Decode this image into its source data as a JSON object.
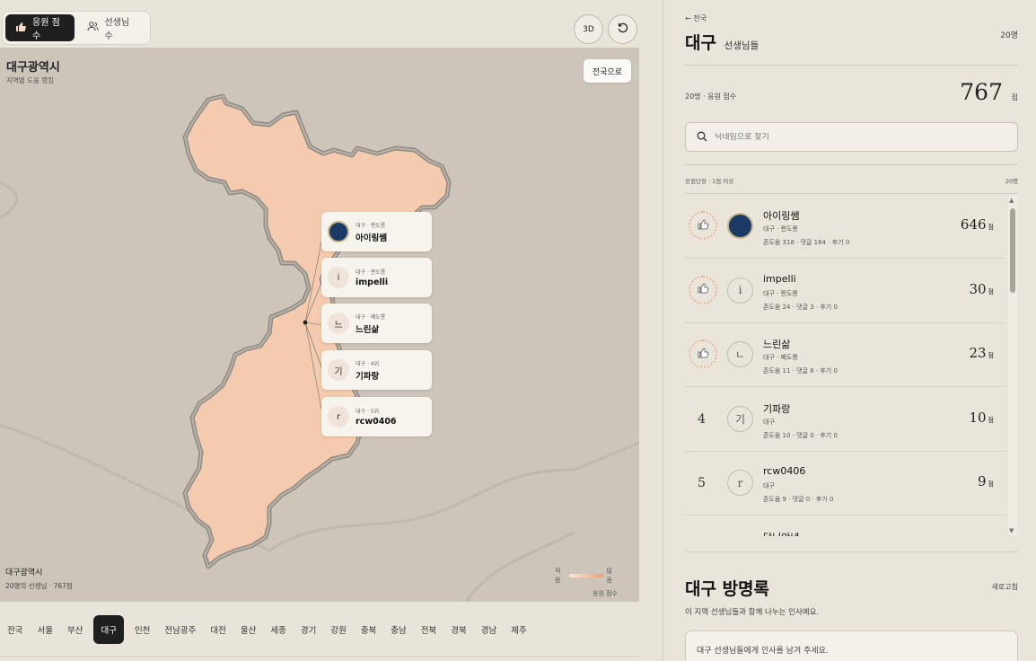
{
  "mode_toggle": {
    "score_label": "응원 점수",
    "teachers_label": "선생님 수"
  },
  "controls": {
    "btn_3d": "3D"
  },
  "map": {
    "title": "대구광역시",
    "subtitle": "지역별 도움 랭킹",
    "to_national": "전국으로",
    "footer_name": "대구광역시",
    "footer_stat": "20명의 선생님 · 767점",
    "legend_low": "적음",
    "legend_high": "많음",
    "legend_caption": "응원 점수",
    "fill_color": "#f4cbae",
    "cards": [
      {
        "meta": "대구 · 쩐도롱",
        "name": "아이링쌤",
        "avatar": ""
      },
      {
        "meta": "대구 · 쩐도롱",
        "name": "impelli",
        "avatar": "i"
      },
      {
        "meta": "대구 · 쩨도롱",
        "name": "느린삶",
        "avatar": "느"
      },
      {
        "meta": "대구 · 4위",
        "name": "기파랑",
        "avatar": "기"
      },
      {
        "meta": "대구 · 5위",
        "name": "rcw0406",
        "avatar": "r"
      }
    ]
  },
  "regions": [
    "전국",
    "서울",
    "부산",
    "대구",
    "인천",
    "전남광주",
    "대전",
    "울산",
    "세종",
    "경기",
    "강원",
    "충북",
    "충남",
    "전북",
    "경북",
    "경남",
    "제주"
  ],
  "active_region": "대구",
  "panel": {
    "back": "← 전국",
    "title": "대구",
    "title_sub": "선생님들",
    "count_top": "20명",
    "score_label": "20명 · 응원 점수",
    "score_value": "767",
    "score_unit": "점",
    "search_placeholder": "닉네임으로 찾기",
    "list_head_left": "응원단장 · 1점 이상",
    "list_head_right": "20명",
    "rows": [
      {
        "rank": "",
        "avatar": "",
        "name": "아이링쌤",
        "region": "대구 · 쩐도롱",
        "stats": "존도움 318 · 댓글 164 · 후기 0",
        "score": "646",
        "unit": "점"
      },
      {
        "rank": "",
        "avatar": "i",
        "name": "impelli",
        "region": "대구 · 쩐도롱",
        "stats": "존도움 24 · 댓글 3 · 후기 0",
        "score": "30",
        "unit": "점"
      },
      {
        "rank": "",
        "avatar": "ㄴ",
        "name": "느린삶",
        "region": "대구 · 쩨도롱",
        "stats": "존도움 11 · 댓글 6 · 후기 0",
        "score": "23",
        "unit": "점"
      },
      {
        "rank": "4",
        "avatar": "기",
        "name": "기파랑",
        "region": "대구",
        "stats": "존도움 10 · 댓글 0 · 후기 0",
        "score": "10",
        "unit": "점"
      },
      {
        "rank": "5",
        "avatar": "r",
        "name": "rcw0406",
        "region": "대구",
        "stats": "존도움 9 · 댓글 0 · 후기 0",
        "score": "9",
        "unit": "점"
      },
      {
        "rank": "",
        "avatar": "",
        "name": "달님안녕",
        "region": "",
        "stats": "",
        "score": "",
        "unit": ""
      }
    ]
  },
  "guestbook": {
    "title": "대구 방명록",
    "refresh": "새로고침",
    "desc": "이 지역 선생님들과 함께 나누는 인사예요.",
    "placeholder": "대구 선생님들에게 인사를 남겨 주세요."
  }
}
